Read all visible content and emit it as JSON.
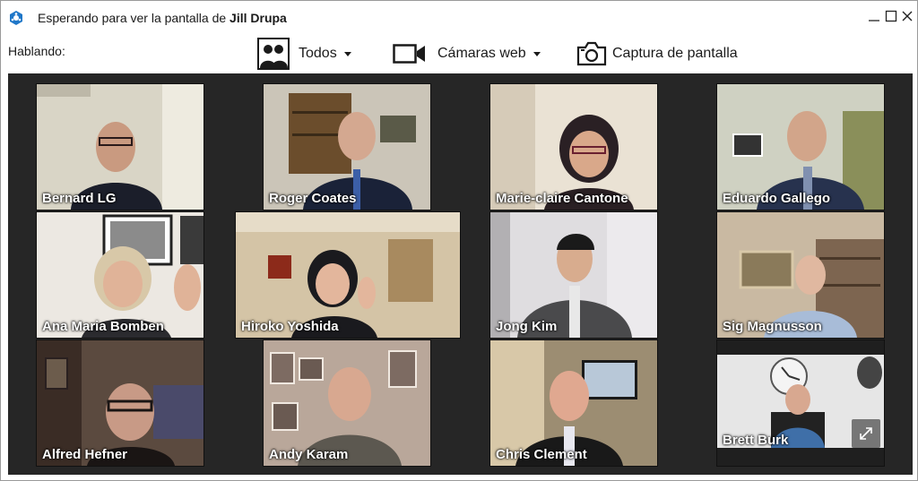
{
  "titlebar": {
    "prefix": "Esperando para ver la pantalla de ",
    "presenter": "Jill Drupa",
    "minimize_icon": "minimize-icon",
    "maximize_icon": "maximize-icon",
    "close_icon": "close-icon"
  },
  "toolbar": {
    "speaking_label": "Hablando:",
    "everyone_label": "Todos",
    "webcams_label": "Cámaras web",
    "screenshot_label": "Captura de pantalla"
  },
  "participants": [
    {
      "name": "Bernard LG",
      "colors": [
        "#cfcab6",
        "#e9e6da",
        "#1b1e2a"
      ]
    },
    {
      "name": "Roger Coates",
      "colors": [
        "#c9c3b5",
        "#6b4d2c",
        "#1a2238"
      ]
    },
    {
      "name": "Marie-claire Cantone",
      "colors": [
        "#e8dfd0",
        "#b2a48e",
        "#2a2024"
      ]
    },
    {
      "name": "Eduardo Gallego",
      "colors": [
        "#cfd1c6",
        "#8a8f5a",
        "#27324e"
      ]
    },
    {
      "name": "Ana Maria Bomben",
      "colors": [
        "#ece8e2",
        "#d3c7b8",
        "#2b2b2f"
      ]
    },
    {
      "name": "Hiroko Yoshida",
      "colors": [
        "#d8c8a8",
        "#a88a5f",
        "#1a1a1e"
      ]
    },
    {
      "name": "Jong Kim",
      "colors": [
        "#dfdde0",
        "#b2b0b3",
        "#4a4a4c"
      ]
    },
    {
      "name": "Sig Magnusson",
      "colors": [
        "#c9b9a2",
        "#7d6550",
        "#5a6f98"
      ]
    },
    {
      "name": "Alfred Hefner",
      "colors": [
        "#5b4a3f",
        "#3a2c25",
        "#1a1514"
      ]
    },
    {
      "name": "Andy Karam",
      "colors": [
        "#b9a79a",
        "#7d6b62",
        "#3b3b42"
      ]
    },
    {
      "name": "Chris Clement",
      "colors": [
        "#9c8d72",
        "#e4c896",
        "#191919"
      ]
    },
    {
      "name": "Brett Burk",
      "colors": [
        "#e6e6e6",
        "#cfcfcf",
        "#3f6fa8"
      ]
    }
  ]
}
